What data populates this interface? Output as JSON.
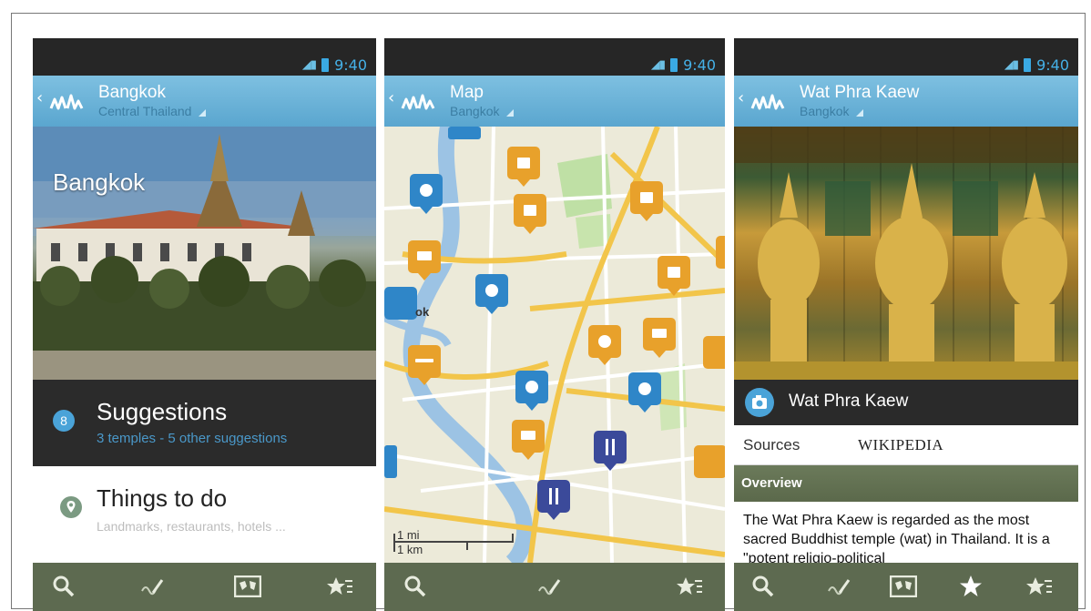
{
  "status": {
    "time": "9:40"
  },
  "phones": [
    {
      "title": "Bangkok",
      "subtitle": "Central Thailand",
      "hero_title": "Bangkok",
      "suggestions": {
        "count": "8",
        "title": "Suggestions",
        "subtitle": "3 temples - 5 other suggestions"
      },
      "things": {
        "title": "Things to do",
        "subtitle": "Landmarks, restaurants, hotels ..."
      },
      "bottom_icons": [
        "search-icon",
        "edit-icon",
        "map-icon",
        "starred-icon"
      ]
    },
    {
      "title": "Map",
      "subtitle": "Bangkok",
      "map_label": "ok",
      "scale": {
        "top": "1 mi",
        "bottom": "1 km"
      },
      "bottom_icons": [
        "search-icon",
        "edit-icon",
        "starred-icon"
      ]
    },
    {
      "title": "Wat Phra Kaew",
      "subtitle": "Bangkok",
      "poi_name": "Wat Phra Kaew",
      "sources_label": "Sources",
      "sources_value": "WIKIPEDIA",
      "overview_label": "Overview",
      "overview_text": "The Wat Phra Kaew is regarded as the most sacred Buddhist temple (wat) in Thailand. It is a \"potent religio-political",
      "bottom_icons": [
        "search-icon",
        "edit-icon",
        "map-icon",
        "star-icon",
        "starred-icon"
      ]
    }
  ],
  "colors": {
    "actionbar": "#6cb4dc",
    "accent_blue": "#4aa3d8",
    "bottombar": "#5d6a50",
    "pin_orange": "#e8a12b",
    "pin_blue": "#2f86c8",
    "pin_navy": "#3b4a9a"
  }
}
